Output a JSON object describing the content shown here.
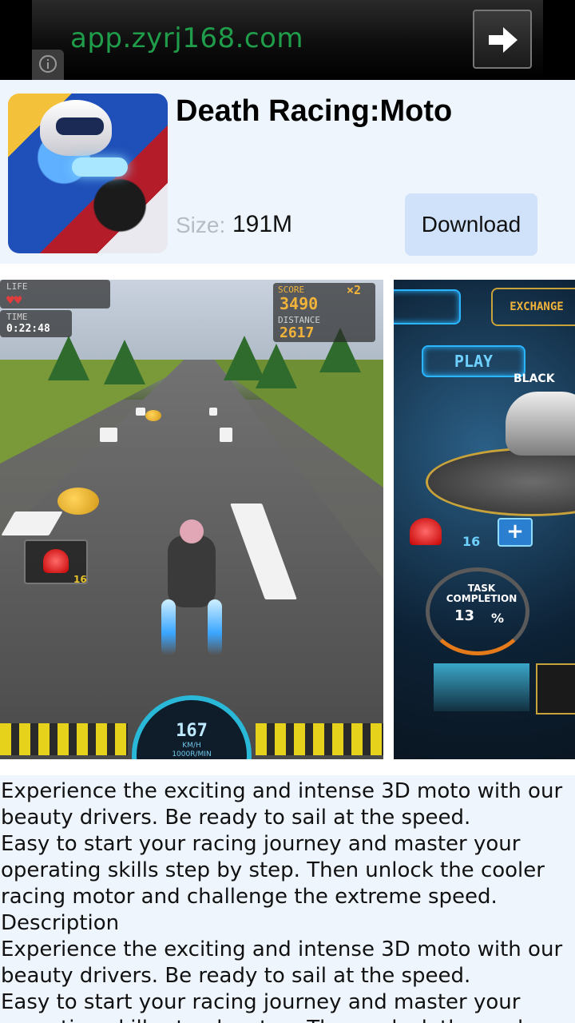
{
  "ad_bar": {
    "url": "app.zyrj168.com",
    "info_icon": "info-icon",
    "go_icon": "arrow-right-icon"
  },
  "app": {
    "title": "Death Racing:Moto",
    "size_label": "Size:",
    "size_value": "191M",
    "download_label": "Download",
    "icon": "moto-racer-app-icon"
  },
  "screenshots": {
    "shot1": {
      "life_label": "LIFE",
      "time_label": "TIME",
      "time_value": "0:22:48",
      "score_label": "SCORE",
      "multiplier": "×2",
      "score_value": "3490",
      "distance_label": "DISTANCE",
      "distance_value": "2617",
      "siren_count": "16",
      "speed": "167",
      "speed_unit": "KM/H",
      "rpm_unit": "1000R/MIN"
    },
    "shot2": {
      "exchange": "EXCHANGE",
      "play": "PLAY",
      "bike_name": "BLACK",
      "siren_count": "16",
      "task_label": "TASK COMPLETION",
      "task_value": "13",
      "percent": "%"
    }
  },
  "description": {
    "lines": [
      "Experience the exciting and intense 3D moto with our",
      "beauty drivers. Be ready to sail at the speed.",
      "Easy to start your racing journey and master your",
      "operating skills step by step. Then unlock the cooler",
      "racing motor and challenge the extreme speed.",
      "Description",
      "Experience the exciting and intense 3D moto with our",
      "beauty drivers. Be ready to sail at the speed.",
      "Easy to start your racing journey and master your",
      "operating skills step by step. Then unlock the cooler"
    ]
  },
  "colors": {
    "ad_url": "#1f9d4a",
    "header_bg": "#eef5fd",
    "download_bg": "#cfe2f9",
    "size_label": "#b7bcc2"
  }
}
